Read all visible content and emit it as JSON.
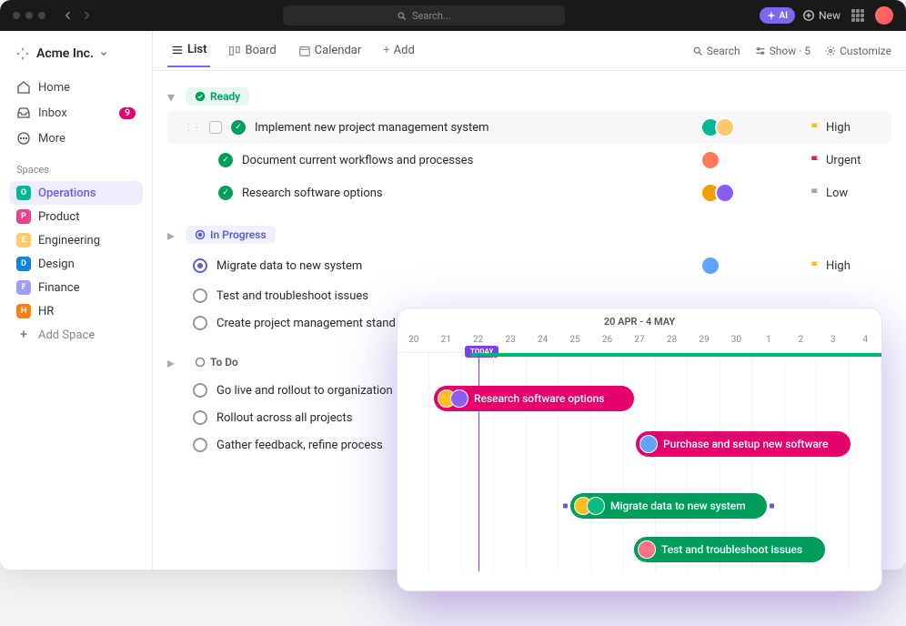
{
  "titlebar": {
    "search_placeholder": "Search...",
    "ai_label": "AI",
    "new_label": "New"
  },
  "workspace": {
    "name": "Acme Inc."
  },
  "sidebar": {
    "home": "Home",
    "inbox": "Inbox",
    "inbox_count": "9",
    "more": "More",
    "spaces_label": "Spaces",
    "add_space": "Add Space",
    "spaces": [
      {
        "letter": "O",
        "name": "Operations",
        "color": "#00b894"
      },
      {
        "letter": "P",
        "name": "Product",
        "color": "#e84393"
      },
      {
        "letter": "E",
        "name": "Engineering",
        "color": "#fdcb6e"
      },
      {
        "letter": "D",
        "name": "Design",
        "color": "#0984e3"
      },
      {
        "letter": "F",
        "name": "Finance",
        "color": "#a29bfe"
      },
      {
        "letter": "H",
        "name": "HR",
        "color": "#fd7e14"
      }
    ]
  },
  "toolbar": {
    "views": {
      "list": "List",
      "board": "Board",
      "calendar": "Calendar",
      "add": "Add"
    },
    "search": "Search",
    "show": "Show · 5",
    "customize": "Customize"
  },
  "groups": {
    "ready": {
      "label": "Ready"
    },
    "in_progress": {
      "label": "In Progress"
    },
    "todo": {
      "label": "To Do"
    }
  },
  "tasks": {
    "ready": [
      {
        "name": "Implement new project management system",
        "priority": "High",
        "flag": "#fbbf24",
        "avatars": [
          "#00b894",
          "#fdcb6e"
        ]
      },
      {
        "name": "Document current workflows and processes",
        "priority": "Urgent",
        "flag": "#e11d48",
        "avatars": [
          "#ff7a59"
        ]
      },
      {
        "name": "Research software options",
        "priority": "Low",
        "flag": "#9ca3af",
        "avatars": [
          "#f59e0b",
          "#8b5cf6"
        ]
      }
    ],
    "in_progress": [
      {
        "name": "Migrate data to new system",
        "priority": "High",
        "flag": "#fbbf24",
        "avatars": [
          "#60a5fa"
        ]
      },
      {
        "name": "Test and troubleshoot issues"
      },
      {
        "name": "Create project management stand"
      }
    ],
    "todo": [
      {
        "name": "Go live and rollout to organization"
      },
      {
        "name": "Rollout across all projects"
      },
      {
        "name": "Gather feedback, refine process"
      }
    ]
  },
  "gantt": {
    "range": "20 APR - 4 MAY",
    "today": "TODAY",
    "dates": [
      "20",
      "21",
      "22",
      "23",
      "24",
      "25",
      "26",
      "27",
      "28",
      "29",
      "30",
      "1",
      "2",
      "3",
      "4"
    ],
    "bars": [
      {
        "label": "Research software options",
        "color": "pink"
      },
      {
        "label": "Purchase and setup new software",
        "color": "pink"
      },
      {
        "label": "Migrate data to new system",
        "color": "green"
      },
      {
        "label": "Test and troubleshoot issues",
        "color": "green"
      }
    ]
  }
}
